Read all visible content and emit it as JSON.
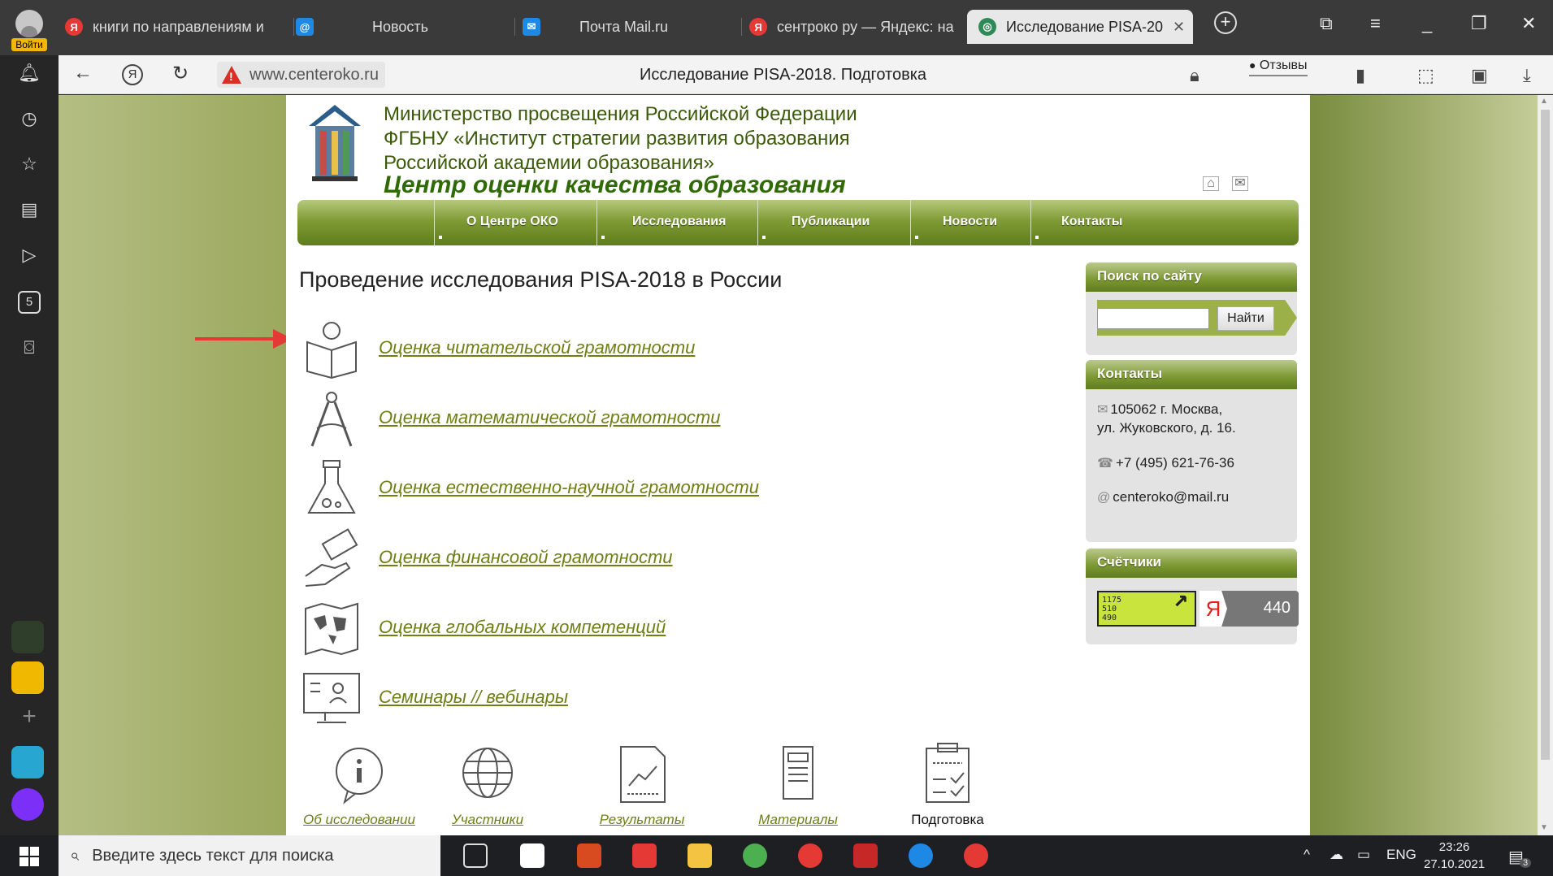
{
  "browser": {
    "profile_label": "Войти",
    "tabs": [
      {
        "label": "книги по направлениям и",
        "icon": "yandex-icon"
      },
      {
        "label": "Новость",
        "icon": "mail-at-icon"
      },
      {
        "label": "Почта Mail.ru",
        "icon": "envelope-icon"
      },
      {
        "label": "сентроко ру — Яндекс: на",
        "icon": "yandex-icon"
      },
      {
        "label": "Исследование PISA-20",
        "icon": "site-favicon",
        "active": true
      }
    ],
    "url": "www.centeroko.ru",
    "page_title": "Исследование PISA-2018. Подготовка",
    "reviews_label": "Отзывы"
  },
  "site": {
    "org_line1": "Министерство просвещения Российской Федерации",
    "org_line2": "ФГБНУ «Институт стратегии развития образования",
    "org_line3": "Российской академии образования»",
    "center_name": "Центр оценки качества образования",
    "menu": [
      "О Центре ОКО",
      "Исследования",
      "Публикации",
      "Новости",
      "Контакты"
    ],
    "heading": "Проведение исследования PISA-2018 в России",
    "links": [
      {
        "label": "Оценка читательской грамотности",
        "icon": "reading-book-icon"
      },
      {
        "label": "Оценка математической грамотности",
        "icon": "compass-icon"
      },
      {
        "label": "Оценка естественно-научной грамотности",
        "icon": "flask-icon"
      },
      {
        "label": "Оценка финансовой грамотности",
        "icon": "money-hand-icon"
      },
      {
        "label": "Оценка глобальных компетенций",
        "icon": "world-map-icon"
      },
      {
        "label": "Семинары // вебинары",
        "icon": "webinar-monitor-icon"
      }
    ],
    "bottom_nav": [
      {
        "label": "Об исследовании",
        "icon": "info-bubble-icon"
      },
      {
        "label": "Участники",
        "icon": "globe-icon"
      },
      {
        "label": "Результаты",
        "icon": "chart-document-icon"
      },
      {
        "label": "Материалы",
        "icon": "document-stack-icon"
      },
      {
        "label": "Подготовка",
        "icon": "clipboard-checklist-icon",
        "current": true
      }
    ],
    "search": {
      "title": "Поиск по сайту",
      "button": "Найти",
      "value": ""
    },
    "contacts": {
      "title": "Контакты",
      "address_line1": "105062 г. Москва,",
      "address_line2": "ул. Жуковского, д. 16.",
      "phone": "+7 (495) 621-76-36",
      "email": "centeroko@mail.ru"
    },
    "counters": {
      "title": "Счётчики",
      "liveinternet_line1": "1175",
      "liveinternet_line2": "510",
      "liveinternet_line3": "490",
      "yandex_count": "440"
    }
  },
  "taskbar": {
    "search_placeholder": "Введите здесь текст для поиска",
    "lang": "ENG",
    "time": "23:26",
    "date": "27.10.2021",
    "notifications": "3"
  },
  "colors": {
    "accent_green": "#6e7f16",
    "menu_green": "#7f9b35",
    "title_green": "#2f6a06",
    "arrow_red": "#e53935"
  }
}
